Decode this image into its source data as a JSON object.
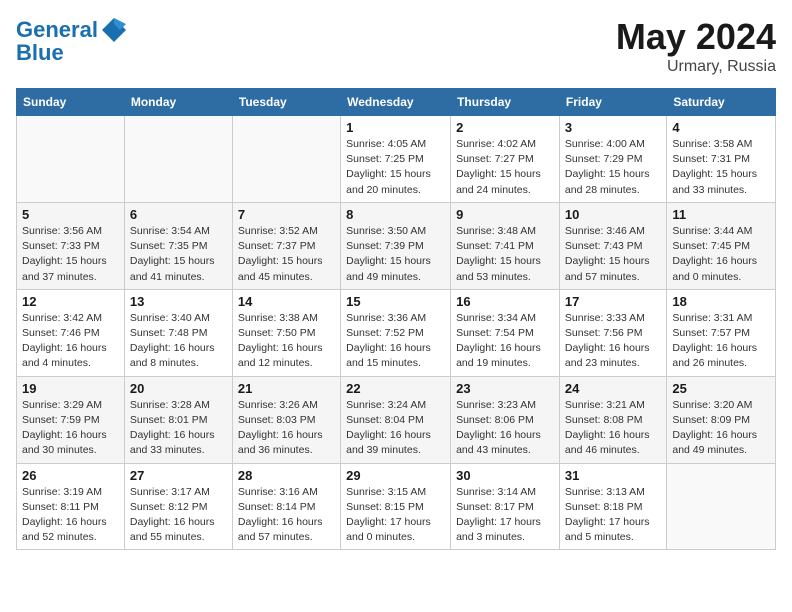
{
  "header": {
    "logo_line1": "General",
    "logo_line2": "Blue",
    "title": "May 2024",
    "location": "Urmary, Russia"
  },
  "weekdays": [
    "Sunday",
    "Monday",
    "Tuesday",
    "Wednesday",
    "Thursday",
    "Friday",
    "Saturday"
  ],
  "weeks": [
    [
      {
        "num": "",
        "info": ""
      },
      {
        "num": "",
        "info": ""
      },
      {
        "num": "",
        "info": ""
      },
      {
        "num": "1",
        "info": "Sunrise: 4:05 AM\nSunset: 7:25 PM\nDaylight: 15 hours\nand 20 minutes."
      },
      {
        "num": "2",
        "info": "Sunrise: 4:02 AM\nSunset: 7:27 PM\nDaylight: 15 hours\nand 24 minutes."
      },
      {
        "num": "3",
        "info": "Sunrise: 4:00 AM\nSunset: 7:29 PM\nDaylight: 15 hours\nand 28 minutes."
      },
      {
        "num": "4",
        "info": "Sunrise: 3:58 AM\nSunset: 7:31 PM\nDaylight: 15 hours\nand 33 minutes."
      }
    ],
    [
      {
        "num": "5",
        "info": "Sunrise: 3:56 AM\nSunset: 7:33 PM\nDaylight: 15 hours\nand 37 minutes."
      },
      {
        "num": "6",
        "info": "Sunrise: 3:54 AM\nSunset: 7:35 PM\nDaylight: 15 hours\nand 41 minutes."
      },
      {
        "num": "7",
        "info": "Sunrise: 3:52 AM\nSunset: 7:37 PM\nDaylight: 15 hours\nand 45 minutes."
      },
      {
        "num": "8",
        "info": "Sunrise: 3:50 AM\nSunset: 7:39 PM\nDaylight: 15 hours\nand 49 minutes."
      },
      {
        "num": "9",
        "info": "Sunrise: 3:48 AM\nSunset: 7:41 PM\nDaylight: 15 hours\nand 53 minutes."
      },
      {
        "num": "10",
        "info": "Sunrise: 3:46 AM\nSunset: 7:43 PM\nDaylight: 15 hours\nand 57 minutes."
      },
      {
        "num": "11",
        "info": "Sunrise: 3:44 AM\nSunset: 7:45 PM\nDaylight: 16 hours\nand 0 minutes."
      }
    ],
    [
      {
        "num": "12",
        "info": "Sunrise: 3:42 AM\nSunset: 7:46 PM\nDaylight: 16 hours\nand 4 minutes."
      },
      {
        "num": "13",
        "info": "Sunrise: 3:40 AM\nSunset: 7:48 PM\nDaylight: 16 hours\nand 8 minutes."
      },
      {
        "num": "14",
        "info": "Sunrise: 3:38 AM\nSunset: 7:50 PM\nDaylight: 16 hours\nand 12 minutes."
      },
      {
        "num": "15",
        "info": "Sunrise: 3:36 AM\nSunset: 7:52 PM\nDaylight: 16 hours\nand 15 minutes."
      },
      {
        "num": "16",
        "info": "Sunrise: 3:34 AM\nSunset: 7:54 PM\nDaylight: 16 hours\nand 19 minutes."
      },
      {
        "num": "17",
        "info": "Sunrise: 3:33 AM\nSunset: 7:56 PM\nDaylight: 16 hours\nand 23 minutes."
      },
      {
        "num": "18",
        "info": "Sunrise: 3:31 AM\nSunset: 7:57 PM\nDaylight: 16 hours\nand 26 minutes."
      }
    ],
    [
      {
        "num": "19",
        "info": "Sunrise: 3:29 AM\nSunset: 7:59 PM\nDaylight: 16 hours\nand 30 minutes."
      },
      {
        "num": "20",
        "info": "Sunrise: 3:28 AM\nSunset: 8:01 PM\nDaylight: 16 hours\nand 33 minutes."
      },
      {
        "num": "21",
        "info": "Sunrise: 3:26 AM\nSunset: 8:03 PM\nDaylight: 16 hours\nand 36 minutes."
      },
      {
        "num": "22",
        "info": "Sunrise: 3:24 AM\nSunset: 8:04 PM\nDaylight: 16 hours\nand 39 minutes."
      },
      {
        "num": "23",
        "info": "Sunrise: 3:23 AM\nSunset: 8:06 PM\nDaylight: 16 hours\nand 43 minutes."
      },
      {
        "num": "24",
        "info": "Sunrise: 3:21 AM\nSunset: 8:08 PM\nDaylight: 16 hours\nand 46 minutes."
      },
      {
        "num": "25",
        "info": "Sunrise: 3:20 AM\nSunset: 8:09 PM\nDaylight: 16 hours\nand 49 minutes."
      }
    ],
    [
      {
        "num": "26",
        "info": "Sunrise: 3:19 AM\nSunset: 8:11 PM\nDaylight: 16 hours\nand 52 minutes."
      },
      {
        "num": "27",
        "info": "Sunrise: 3:17 AM\nSunset: 8:12 PM\nDaylight: 16 hours\nand 55 minutes."
      },
      {
        "num": "28",
        "info": "Sunrise: 3:16 AM\nSunset: 8:14 PM\nDaylight: 16 hours\nand 57 minutes."
      },
      {
        "num": "29",
        "info": "Sunrise: 3:15 AM\nSunset: 8:15 PM\nDaylight: 17 hours\nand 0 minutes."
      },
      {
        "num": "30",
        "info": "Sunrise: 3:14 AM\nSunset: 8:17 PM\nDaylight: 17 hours\nand 3 minutes."
      },
      {
        "num": "31",
        "info": "Sunrise: 3:13 AM\nSunset: 8:18 PM\nDaylight: 17 hours\nand 5 minutes."
      },
      {
        "num": "",
        "info": ""
      }
    ]
  ]
}
